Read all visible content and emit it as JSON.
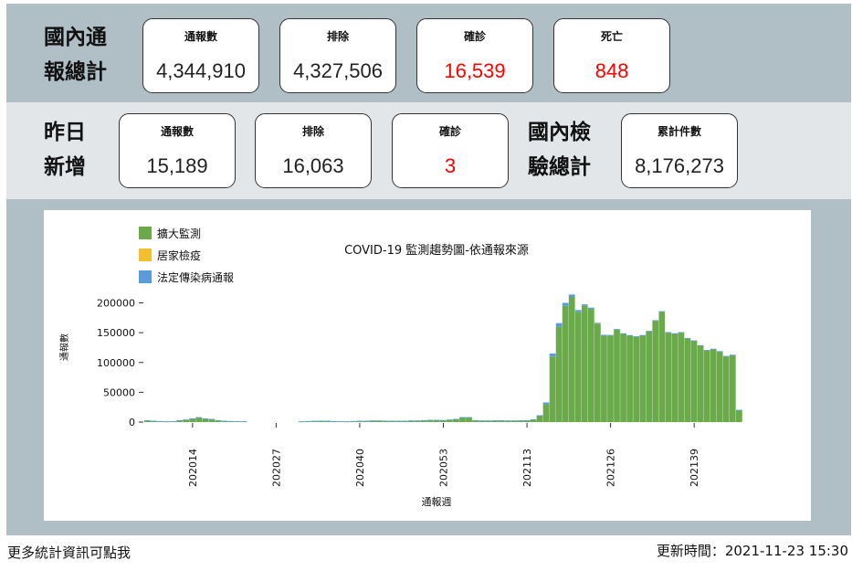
{
  "domestic_total": {
    "label_line1": "國內通",
    "label_line2": "報總計",
    "cards": [
      {
        "label": "通報數",
        "value": "4,344,910",
        "highlight": false
      },
      {
        "label": "排除",
        "value": "4,327,506",
        "highlight": false
      },
      {
        "label": "確診",
        "value": "16,539",
        "highlight": true
      },
      {
        "label": "死亡",
        "value": "848",
        "highlight": true
      }
    ]
  },
  "yesterday": {
    "label_line1": "昨日",
    "label_line2": "新增",
    "cards": [
      {
        "label": "通報數",
        "value": "15,189",
        "highlight": false
      },
      {
        "label": "排除",
        "value": "16,063",
        "highlight": false
      },
      {
        "label": "確診",
        "value": "3",
        "highlight": true
      }
    ]
  },
  "testing_total": {
    "label_line1": "國內檢",
    "label_line2": "驗總計",
    "card": {
      "label": "累計件數",
      "value": "8,176,273"
    }
  },
  "footer": {
    "more_stats_link": "更多統計資訊可點我",
    "updated": "更新時間：2021-11-23 15:30"
  },
  "colors": {
    "green": "#6aaa4a",
    "yellow": "#f0c030",
    "blue": "#5a9bd8",
    "red": "#ff0000"
  },
  "chart_data": {
    "type": "bar",
    "title": "COVID-19 監測趨勢圖-依通報來源",
    "xlabel": "通報週",
    "ylabel": "通報數",
    "ylim": [
      0,
      210000
    ],
    "yticks": [
      "0",
      "50000",
      "100000",
      "150000",
      "200000"
    ],
    "xticks": [
      "202014",
      "202027",
      "202040",
      "202053",
      "202113",
      "202126",
      "202139"
    ],
    "legend": [
      "擴大監測",
      "居家檢疫",
      "法定傳染病通報"
    ],
    "legend_position": "top-left",
    "series": [
      {
        "name": "擴大監測",
        "color": "#6aaa4a",
        "values": [
          3000,
          2000,
          1500,
          1000,
          1200,
          3000,
          4000,
          6000,
          8000,
          6000,
          5000,
          3000,
          2000,
          1500,
          1200,
          1000,
          0,
          0,
          0,
          0,
          0,
          0,
          0,
          0,
          1000,
          1500,
          1800,
          2000,
          2000,
          1500,
          1200,
          1000,
          1500,
          2000,
          2000,
          2500,
          2500,
          2200,
          2000,
          2000,
          2000,
          2500,
          2500,
          3000,
          3500,
          3500,
          3200,
          4000,
          5000,
          8000,
          8000,
          3000,
          2500,
          2500,
          2800,
          2800,
          2500,
          2500,
          2800,
          3000,
          4000,
          10000,
          30000,
          110000,
          160000,
          195000,
          210000,
          185000,
          195000,
          190000,
          165000,
          145000,
          145000,
          155000,
          148000,
          145000,
          143000,
          145000,
          152000,
          170000,
          185000,
          150000,
          148000,
          150000,
          140000,
          136000,
          128000,
          120000,
          122000,
          118000,
          110000,
          112000,
          20000
        ]
      },
      {
        "name": "居家檢疫",
        "color": "#f0c030",
        "values": [
          0,
          0,
          0,
          0,
          0,
          0,
          0,
          0,
          0,
          0,
          0,
          0,
          0,
          0,
          0,
          0,
          0,
          0,
          0,
          0,
          0,
          0,
          0,
          0,
          0,
          0,
          0,
          0,
          0,
          0,
          0,
          0,
          0,
          0,
          0,
          0,
          0,
          0,
          0,
          0,
          0,
          0,
          0,
          0,
          0,
          0,
          0,
          0,
          0,
          0,
          0,
          0,
          0,
          0,
          0,
          0,
          0,
          0,
          0,
          0,
          0,
          0,
          0,
          0,
          0,
          0,
          0,
          0,
          0,
          0,
          0,
          0,
          0,
          0,
          0,
          0,
          0,
          0,
          0,
          0,
          0,
          0,
          0,
          0,
          0,
          0,
          0,
          0,
          0,
          0,
          0,
          0,
          0
        ]
      },
      {
        "name": "法定傳染病通報",
        "color": "#5a9bd8",
        "values": [
          200,
          200,
          200,
          200,
          200,
          200,
          200,
          200,
          200,
          200,
          200,
          200,
          200,
          200,
          200,
          200,
          0,
          0,
          0,
          0,
          0,
          0,
          0,
          0,
          200,
          200,
          200,
          200,
          200,
          200,
          200,
          200,
          200,
          200,
          200,
          200,
          200,
          200,
          200,
          200,
          200,
          200,
          200,
          200,
          200,
          200,
          200,
          200,
          200,
          200,
          200,
          200,
          200,
          200,
          200,
          200,
          200,
          200,
          200,
          200,
          500,
          1500,
          3000,
          5000,
          6000,
          5000,
          4000,
          3000,
          2500,
          2000,
          1500,
          1500,
          1200,
          1200,
          1000,
          1000,
          1000,
          1000,
          1000,
          1000,
          1000,
          1000,
          1000,
          1000,
          1000,
          1000,
          1000,
          1000,
          1000,
          1000,
          1000,
          1000,
          500
        ]
      }
    ]
  }
}
